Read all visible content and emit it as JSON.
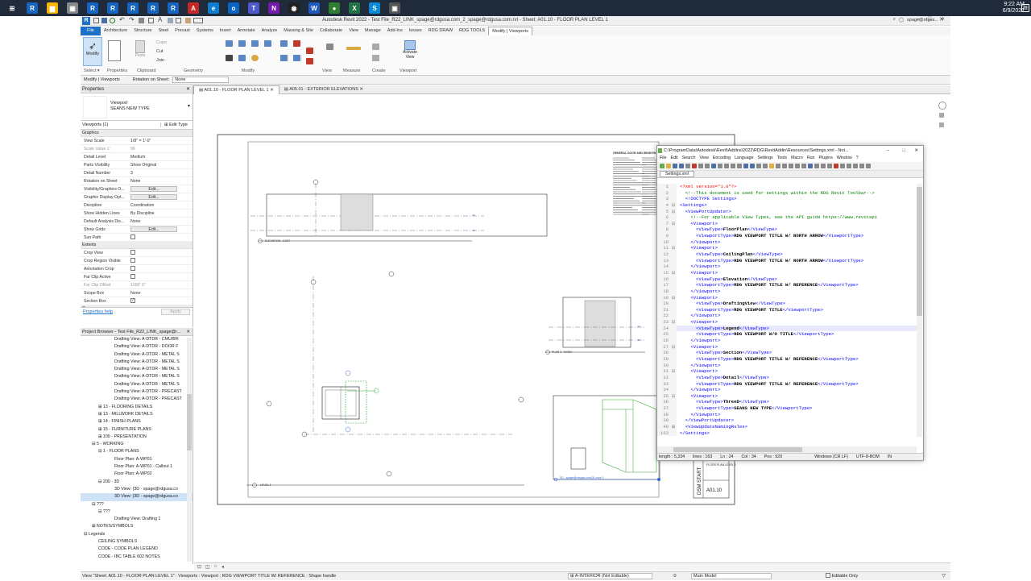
{
  "taskbar": {
    "time": "9:22 AM",
    "date": "6/9/2021",
    "icons": [
      {
        "name": "windows-icon",
        "color": "#ffffff",
        "glyph": "⊞"
      },
      {
        "name": "revit-icon",
        "color": "#1565c0",
        "glyph": "R"
      },
      {
        "name": "file-explorer-icon",
        "color": "#f4b400",
        "glyph": "▆"
      },
      {
        "name": "store-icon",
        "color": "#888",
        "glyph": "▦"
      },
      {
        "name": "revit-icon",
        "color": "#1565c0",
        "glyph": "R"
      },
      {
        "name": "revit-icon",
        "color": "#1565c0",
        "glyph": "R"
      },
      {
        "name": "revit-icon",
        "color": "#1565c0",
        "glyph": "R"
      },
      {
        "name": "revit-icon",
        "color": "#1565c0",
        "glyph": "R"
      },
      {
        "name": "revit-icon",
        "color": "#1565c0",
        "glyph": "R"
      },
      {
        "name": "autocad-icon",
        "color": "#c62828",
        "glyph": "A"
      },
      {
        "name": "edge-icon",
        "color": "#0f7ccf",
        "glyph": "e"
      },
      {
        "name": "outlook-icon",
        "color": "#0a64c4",
        "glyph": "o"
      },
      {
        "name": "teams-icon",
        "color": "#5059c9",
        "glyph": "T"
      },
      {
        "name": "onenote-icon",
        "color": "#7719aa",
        "glyph": "N"
      },
      {
        "name": "camera-icon",
        "color": "#222",
        "glyph": "◉"
      },
      {
        "name": "word-icon",
        "color": "#1e5bbf",
        "glyph": "W"
      },
      {
        "name": "chrome-icon",
        "color": "#2e7d32",
        "glyph": "●"
      },
      {
        "name": "excel-icon",
        "color": "#1f7244",
        "glyph": "X"
      },
      {
        "name": "skype-icon",
        "color": "#0a8ad6",
        "glyph": "S"
      },
      {
        "name": "app-icon",
        "color": "#555",
        "glyph": "▣"
      }
    ]
  },
  "revit": {
    "title": "Autodesk Revit 2022 - Test File_R22_LINK_spage@rdgusa.com_2_spage@rdgusa.com.rvt - Sheet: A01.10 - FLOOR PLAN LEVEL 1",
    "user": "spage@rdgus...",
    "tabs": [
      "File",
      "Architecture",
      "Structure",
      "Steel",
      "Precast",
      "Systems",
      "Insert",
      "Annotate",
      "Analyze",
      "Massing & Site",
      "Collaborate",
      "View",
      "Manage",
      "Add-Ins",
      "Issues",
      "RDG DRAW",
      "RDG TOOLS",
      "Modify | Viewports"
    ],
    "active_tab": "Modify | Viewports",
    "ribbon": {
      "modify_label": "Modify",
      "paste_label": "Paste",
      "cope_label": "Cope",
      "cut_label": "Cut",
      "join_label": "Join",
      "activate_view_label": "Activate View",
      "panels": [
        "Select ▾",
        "Properties",
        "Clipboard",
        "Geometry",
        "Modify",
        "View",
        "Measure",
        "Create",
        "Viewport"
      ]
    },
    "options_bar": {
      "context": "Modify | Viewports",
      "rotation_label": "Rotation on Sheet:",
      "rotation_value": "None"
    },
    "view_tabs": [
      "A01.10 - FLOOR PLAN LEVEL 1",
      "A05.01 - EXTERIOR ELEVATIONS"
    ]
  },
  "properties": {
    "title": "Properties",
    "type_line1": "Viewport",
    "type_line2": "SEANS NEW TYPE",
    "filter": "Viewports (1)",
    "edit_type": "Edit Type",
    "sections": [
      {
        "name": "Graphics",
        "rows": [
          {
            "k": "View Scale",
            "v": "1/8\" = 1'-0\""
          },
          {
            "k": "Scale Value  1:",
            "v": "96",
            "muted": true
          },
          {
            "k": "Detail Level",
            "v": "Medium"
          },
          {
            "k": "Parts Visibility",
            "v": "Show Original"
          },
          {
            "k": "Detail Number",
            "v": "3"
          },
          {
            "k": "Rotation on Sheet",
            "v": "None"
          },
          {
            "k": "Visibility/Graphics O...",
            "v": "Edit...",
            "btn": true
          },
          {
            "k": "Graphic Display Opt...",
            "v": "Edit...",
            "btn": true
          },
          {
            "k": "Discipline",
            "v": "Coordination"
          },
          {
            "k": "Show Hidden Lines",
            "v": "By Discipline"
          },
          {
            "k": "Default Analysis Dis...",
            "v": "None"
          },
          {
            "k": "Show Grids",
            "v": "Edit...",
            "btn": true
          },
          {
            "k": "Sun Path",
            "v": "",
            "chk": true
          }
        ]
      },
      {
        "name": "Extents",
        "rows": [
          {
            "k": "Crop View",
            "v": "",
            "chk": true
          },
          {
            "k": "Crop Region Visible",
            "v": "",
            "chk": true
          },
          {
            "k": "Annotation Crop",
            "v": "",
            "chk": true
          },
          {
            "k": "Far Clip Active",
            "v": "",
            "chk": true
          },
          {
            "k": "Far Clip Offset",
            "v": "1000' 0\"",
            "muted": true
          },
          {
            "k": "Scope Box",
            "v": "None"
          },
          {
            "k": "Section Box",
            "v": "✓",
            "chk": true
          }
        ]
      },
      {
        "name": "Camera",
        "rows": []
      }
    ],
    "help": "Properties help",
    "apply": "Apply"
  },
  "browser": {
    "title": "Project Browser - Test File_R22_LINK_spage@r...",
    "items": [
      {
        "t": "Drafting View: A-DTDR - CMU/BR",
        "i": 42
      },
      {
        "t": "Drafting View: A-DTDR - DOOR F",
        "i": 42
      },
      {
        "t": "Drafting View: A-DTDR - METAL S",
        "i": 42
      },
      {
        "t": "Drafting View: A-DTDR - METAL S",
        "i": 42
      },
      {
        "t": "Drafting View: A-DTDR - METAL S",
        "i": 42
      },
      {
        "t": "Drafting View: A-DTDR - METAL S",
        "i": 42
      },
      {
        "t": "Drafting View: A-DTDR - METAL S",
        "i": 42
      },
      {
        "t": "Drafting View: A-DTDR - PRECAST",
        "i": 42
      },
      {
        "t": "Drafting View: A-DTDR - PRECAST",
        "i": 42
      },
      {
        "t": "⊞ 13 - FLOORING DETAILS",
        "i": 22
      },
      {
        "t": "⊞ 13 - MILLWORK DETAILS",
        "i": 22
      },
      {
        "t": "⊞ 14 - FINISH PLANS",
        "i": 22
      },
      {
        "t": "⊞ 15 - FURNITURE PLANS",
        "i": 22
      },
      {
        "t": "⊞ 100 - PRESENTATION",
        "i": 22
      },
      {
        "t": "⊟ 5 - WORKING",
        "i": 14
      },
      {
        "t": "⊟ 1 - FLOOR PLANS",
        "i": 22
      },
      {
        "t": "Floor Plan: A-WP01",
        "i": 42
      },
      {
        "t": "Floor Plan: A-WP01 - Callout 1",
        "i": 42
      },
      {
        "t": "Floor Plan: A-WP02",
        "i": 42
      },
      {
        "t": "⊟ 200 - 3D",
        "i": 22
      },
      {
        "t": "3D View: {3D - spage@rdgusa.co",
        "i": 42
      },
      {
        "t": "3D View: {3D - spage@rdgusa.co",
        "i": 42,
        "sel": true
      },
      {
        "t": "⊟ ???",
        "i": 14
      },
      {
        "t": "⊟ ???",
        "i": 22
      },
      {
        "t": "Drafting View: Drafting 1",
        "i": 42
      },
      {
        "t": "⊞ NOTES/SYMBOLS",
        "i": 14
      },
      {
        "t": "⊟ Legends",
        "i": 4
      },
      {
        "t": "CEILING SYMBOLS",
        "i": 22
      },
      {
        "t": "CODE - CODE PLAN LEGEND",
        "i": 22
      },
      {
        "t": "CODE - IBC TABLE 602 NOTES",
        "i": 22
      }
    ]
  },
  "sheet": {
    "number": "A01.10",
    "name": "FLOOR PLAN LEVEL 1",
    "view_title_1": "ELEVATION - EAST",
    "view_title_2": "PLAN 1 - AXON",
    "view_title_3": "LEVEL 1",
    "view_title_4": "3D - spage@rdgusa.com(3) copy 1",
    "notes_title": "GENERAL DOOR AND WINDOW NOTES"
  },
  "notepad": {
    "title": "C:\\ProgramData\\Autodesk\\Revit\\Addins\\2022\\RDG\\RevitAddin\\Resources\\Settings.xml - Not...",
    "menu": [
      "File",
      "Edit",
      "Search",
      "View",
      "Encoding",
      "Language",
      "Settings",
      "Tools",
      "Macro",
      "Run",
      "Plugins",
      "Window",
      "?"
    ],
    "file_tab": "Settings.xml",
    "lines": [
      {
        "n": "1",
        "f": "",
        "h": "<span class=\"pi\">&lt;?xml version=\"1.0\"?&gt;</span>"
      },
      {
        "n": "2",
        "f": "",
        "h": "<span class=\"cm\">  &lt;!--This document is used for settings within the RDG Revit Toolbar--&gt;</span>"
      },
      {
        "n": "3",
        "f": "",
        "h": "<span class=\"t\">  &lt;!DOCTYPE Settings&gt;</span>"
      },
      {
        "n": "4",
        "f": "⊟",
        "h": "<span class=\"t\">&lt;Settings&gt;</span>"
      },
      {
        "n": "5",
        "f": "⊟",
        "h": "<span class=\"t\">  &lt;ViewPortUpdater&gt;</span>"
      },
      {
        "n": "6",
        "f": "",
        "h": "<span class=\"cm\">    &lt;!--For applicable View Types, see the API guide https://www.revitapi</span>"
      },
      {
        "n": "7",
        "f": "⊟",
        "h": "<span class=\"t\">    &lt;Viewport&gt;</span>"
      },
      {
        "n": "8",
        "f": "",
        "h": "<span class=\"t\">      &lt;ViewType&gt;</span><span class=\"tx\">FloorPlan</span><span class=\"t\">&lt;/ViewType&gt;</span>"
      },
      {
        "n": "9",
        "f": "",
        "h": "<span class=\"t\">      &lt;ViewportType&gt;</span><span class=\"tx\">RDG VIEWPORT TITLE W/ NORTH ARROW</span><span class=\"t\">&lt;/ViewportType&gt;</span>"
      },
      {
        "n": "10",
        "f": "",
        "h": "<span class=\"t\">    &lt;/Viewport&gt;</span>"
      },
      {
        "n": "11",
        "f": "⊟",
        "h": "<span class=\"t\">    &lt;Viewport&gt;</span>"
      },
      {
        "n": "12",
        "f": "",
        "h": "<span class=\"t\">      &lt;ViewType&gt;</span><span class=\"tx\">CeilingPlan</span><span class=\"t\">&lt;/ViewType&gt;</span>"
      },
      {
        "n": "13",
        "f": "",
        "h": "<span class=\"t\">      &lt;ViewportType&gt;</span><span class=\"tx\">RDG VIEWPORT TITLE W/ NORTH ARROW</span><span class=\"t\">&lt;/ViewportType&gt;</span>"
      },
      {
        "n": "14",
        "f": "",
        "h": "<span class=\"t\">    &lt;/Viewport&gt;</span>"
      },
      {
        "n": "15",
        "f": "⊟",
        "h": "<span class=\"t\">    &lt;Viewport&gt;</span>"
      },
      {
        "n": "16",
        "f": "",
        "h": "<span class=\"t\">      &lt;ViewType&gt;</span><span class=\"tx\">Elevation</span><span class=\"t\">&lt;/ViewType&gt;</span>"
      },
      {
        "n": "17",
        "f": "",
        "h": "<span class=\"t\">      &lt;ViewportType&gt;</span><span class=\"tx\">RDG VIEWPORT TITLE W/ REFERENCE</span><span class=\"t\">&lt;/ViewportType&gt;</span>"
      },
      {
        "n": "18",
        "f": "",
        "h": "<span class=\"t\">    &lt;/Viewport&gt;</span>"
      },
      {
        "n": "19",
        "f": "⊟",
        "h": "<span class=\"t\">    &lt;Viewport&gt;</span>"
      },
      {
        "n": "20",
        "f": "",
        "h": "<span class=\"t\">      &lt;ViewType&gt;</span><span class=\"tx\">DraftingView</span><span class=\"t\">&lt;/ViewType&gt;</span>"
      },
      {
        "n": "21",
        "f": "",
        "h": "<span class=\"t\">      &lt;ViewportType&gt;</span><span class=\"tx\">RDG VIEWPORT TITLE</span><span class=\"t\">&lt;/ViewportType&gt;</span>"
      },
      {
        "n": "22",
        "f": "",
        "h": "<span class=\"t\">    &lt;/Viewport&gt;</span>"
      },
      {
        "n": "23",
        "f": "⊟",
        "h": "<span class=\"t\">    &lt;Viewport&gt;</span>"
      },
      {
        "n": "24",
        "f": "",
        "h": "<span class=\"t\">      &lt;ViewType&gt;</span><span class=\"tx\">Legend</span><span class=\"t\">&lt;/ViewType&gt;</span>",
        "hl": true
      },
      {
        "n": "25",
        "f": "",
        "h": "<span class=\"t\">      &lt;ViewportType&gt;</span><span class=\"tx\">RDG VIEWPORT W/O TITLE</span><span class=\"t\">&lt;/ViewportType&gt;</span>"
      },
      {
        "n": "26",
        "f": "",
        "h": "<span class=\"t\">    &lt;/Viewport&gt;</span>"
      },
      {
        "n": "27",
        "f": "⊟",
        "h": "<span class=\"t\">    &lt;Viewport&gt;</span>"
      },
      {
        "n": "28",
        "f": "",
        "h": "<span class=\"t\">      &lt;ViewType&gt;</span><span class=\"tx\">Section</span><span class=\"t\">&lt;/ViewType&gt;</span>"
      },
      {
        "n": "29",
        "f": "",
        "h": "<span class=\"t\">      &lt;ViewportType&gt;</span><span class=\"tx\">RDG VIEWPORT TITLE W/ REFERENCE</span><span class=\"t\">&lt;/ViewportType&gt;</span>"
      },
      {
        "n": "30",
        "f": "",
        "h": "<span class=\"t\">    &lt;/Viewport&gt;</span>"
      },
      {
        "n": "31",
        "f": "⊟",
        "h": "<span class=\"t\">    &lt;Viewport&gt;</span>"
      },
      {
        "n": "32",
        "f": "",
        "h": "<span class=\"t\">      &lt;ViewType&gt;</span><span class=\"tx\">Detail</span><span class=\"t\">&lt;/ViewType&gt;</span>"
      },
      {
        "n": "33",
        "f": "",
        "h": "<span class=\"t\">      &lt;ViewportType&gt;</span><span class=\"tx\">RDG VIEWPORT TITLE W/ REFERENCE</span><span class=\"t\">&lt;/ViewportType&gt;</span>"
      },
      {
        "n": "34",
        "f": "",
        "h": "<span class=\"t\">    &lt;/Viewport&gt;</span>"
      },
      {
        "n": "35",
        "f": "⊟",
        "h": "<span class=\"t\">    &lt;Viewport&gt;</span>"
      },
      {
        "n": "36",
        "f": "",
        "h": "<span class=\"t\">      &lt;ViewType&gt;</span><span class=\"tx\">ThreeD</span><span class=\"t\">&lt;/ViewType&gt;</span>"
      },
      {
        "n": "37",
        "f": "",
        "h": "<span class=\"t\">      &lt;ViewportType&gt;</span><span class=\"tx\">SEANS NEW TYPE</span><span class=\"t\">&lt;/ViewportType&gt;</span>"
      },
      {
        "n": "38",
        "f": "",
        "h": "<span class=\"t\">    &lt;/Viewport&gt;</span>"
      },
      {
        "n": "39",
        "f": "",
        "h": "<span class=\"t\">  &lt;/ViewPortUpdater&gt;</span>"
      },
      {
        "n": "40",
        "f": "⊞",
        "h": "<span class=\"t\">  &lt;ViewUpdateNamingRules&gt;</span>"
      },
      {
        "n": "163",
        "f": "",
        "h": "<span class=\"t\">&lt;/Settings&gt;</span>"
      }
    ],
    "status": {
      "length": "length : 5,334",
      "lines": "lines : 163",
      "ln": "Ln : 24",
      "col": "Col : 34",
      "pos": "Pos : 929",
      "eol": "Windows (CR LF)",
      "enc": "UTF-8-BOM",
      "mode": "IN"
    }
  },
  "statusbar": {
    "text": "View \"Sheet: A01.10 - FLOOR PLAN LEVEL 1\" : Viewports : Viewport : RDG VIEWPORT TITLE W/ REFERENCE : Shape handle",
    "workset": "A-INTERIOR (Not Editable)",
    "design_option": "Main Model",
    "editable_only": "Editable Only",
    "count": ":0"
  },
  "colors": {
    "accent": "#1e6fc7",
    "taskbar": "#1f2a3a",
    "green_selection": "#3aa63a"
  }
}
